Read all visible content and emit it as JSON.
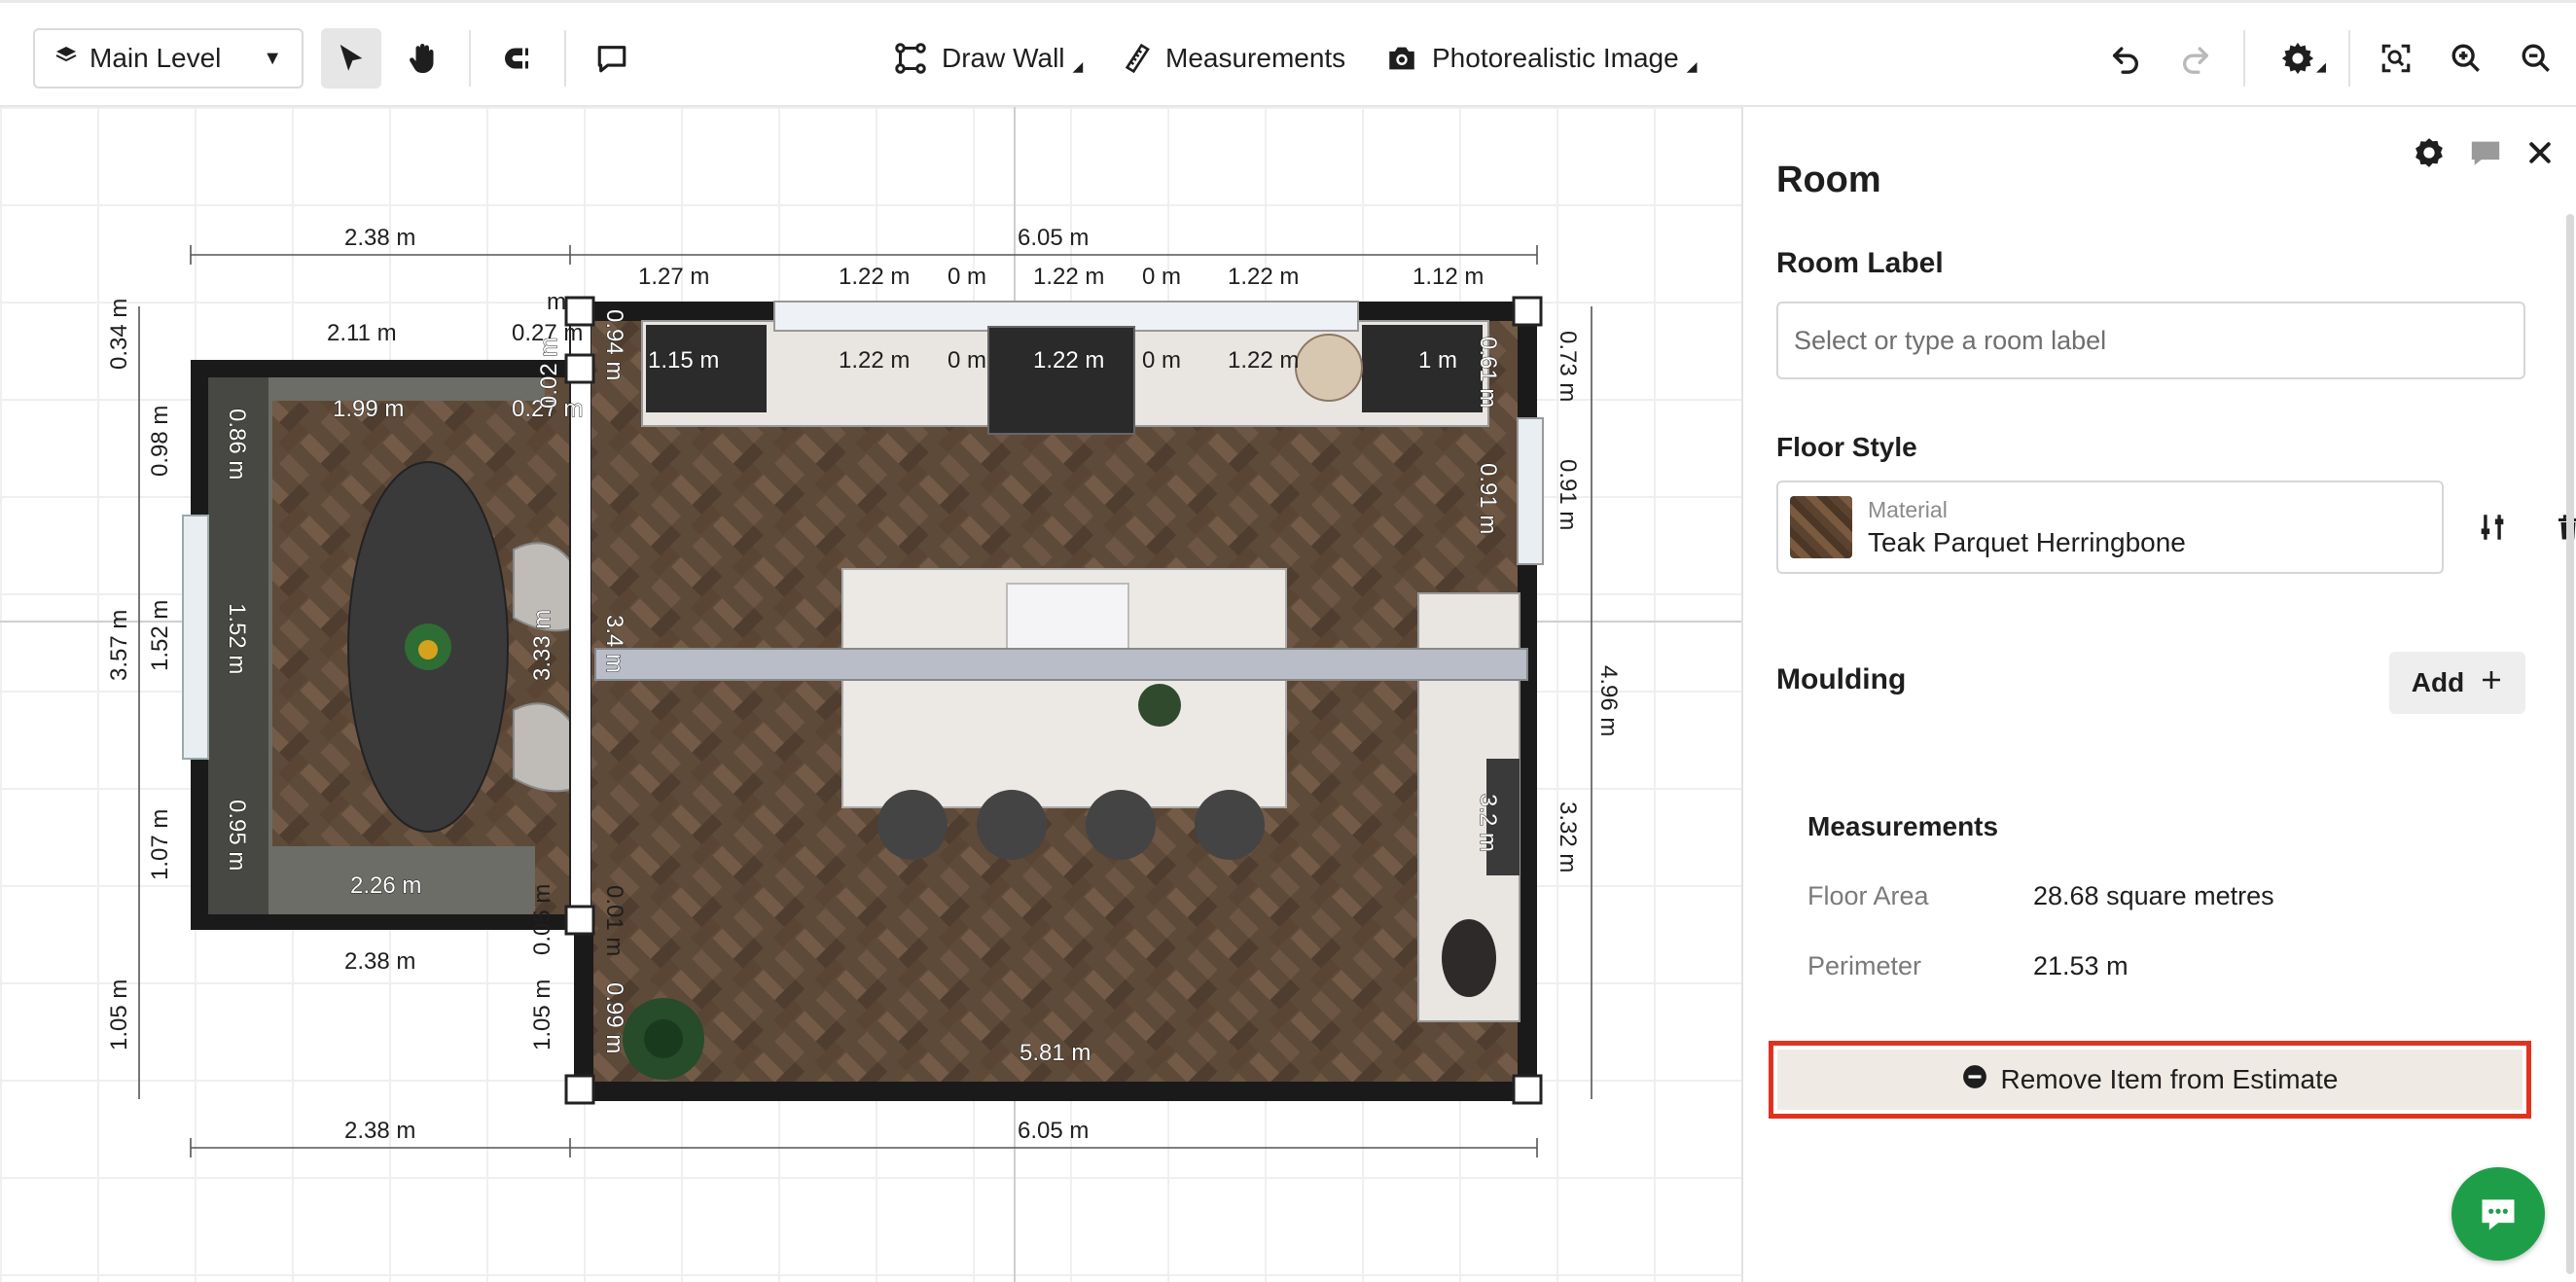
{
  "toolbar": {
    "level": "Main Level",
    "draw_wall": "Draw Wall",
    "measurements": "Measurements",
    "photoreal": "Photorealistic Image"
  },
  "panel": {
    "title": "Room",
    "room_label_heading": "Room Label",
    "room_label_placeholder": "Select or type a room label",
    "floor_style_heading": "Floor Style",
    "material_caption": "Material",
    "material_name": "Teak Parquet Herringbone",
    "moulding_heading": "Moulding",
    "add_label": "Add",
    "measurements_heading": "Measurements",
    "floor_area_label": "Floor Area",
    "floor_area_value": "28.68 square metres",
    "perimeter_label": "Perimeter",
    "perimeter_value": "21.53 m",
    "remove_label": "Remove Item from Estimate"
  },
  "plan": {
    "dims": {
      "top_left_width": "2.38 m",
      "top_total": "6.05 m",
      "seg_1": "1.27 m",
      "seg_2": "1.22 m",
      "seg_3": "0 m",
      "seg_4": "1.22 m",
      "seg_5": "0 m",
      "seg_6": "1.22 m",
      "seg_7": "1.12 m",
      "inner_1": "1.15 m",
      "inner_2": "1.22 m",
      "inner_3": "0 m",
      "inner_4": "1.22 m",
      "inner_5": "0 m",
      "inner_6": "1.22 m",
      "inner_7": "1 m",
      "dining_top": "2.11 m",
      "dining_inner_top": "1.99 m",
      "small_1": "0.27 m",
      "small_2": "0.27 m",
      "small_3": "0.02 m",
      "small_4": "0.94 m",
      "left_1": "0.34 m",
      "left_2": "0.98 m",
      "left_3": "1.52 m",
      "left_4": "3.57 m",
      "left_5": "1.07 m",
      "left_6": "1.05 m",
      "inner_left_1": "0.86 m",
      "inner_left_2": "1.52 m",
      "inner_left_3": "0.95 m",
      "dining_bottom_inner": "2.26 m",
      "dining_bottom": "2.38 m",
      "partition_1": "3.33 m",
      "partition_2": "3.4 m",
      "small_5": "0.05 m",
      "small_6": "0.01 m",
      "small_7": "0.99 m",
      "small_8": "1.05 m",
      "right_1": "0.73 m",
      "right_2": "0.91 m",
      "right_3": "4.96 m",
      "right_4": "3.32 m",
      "inner_right_1": "0.61 m",
      "inner_right_2": "0.91 m",
      "inner_right_3": "3.2 m",
      "bottom_inner": "5.81 m",
      "bottom_left": "2.38 m",
      "bottom_total": "6.05 m",
      "top_right_small": "m",
      "small_9": "m"
    }
  },
  "colors": {
    "accent_red": "#e0331f",
    "chat_green": "#1f9e49",
    "floor_wood": "#5b4634",
    "wall": "#1a1a1a"
  }
}
